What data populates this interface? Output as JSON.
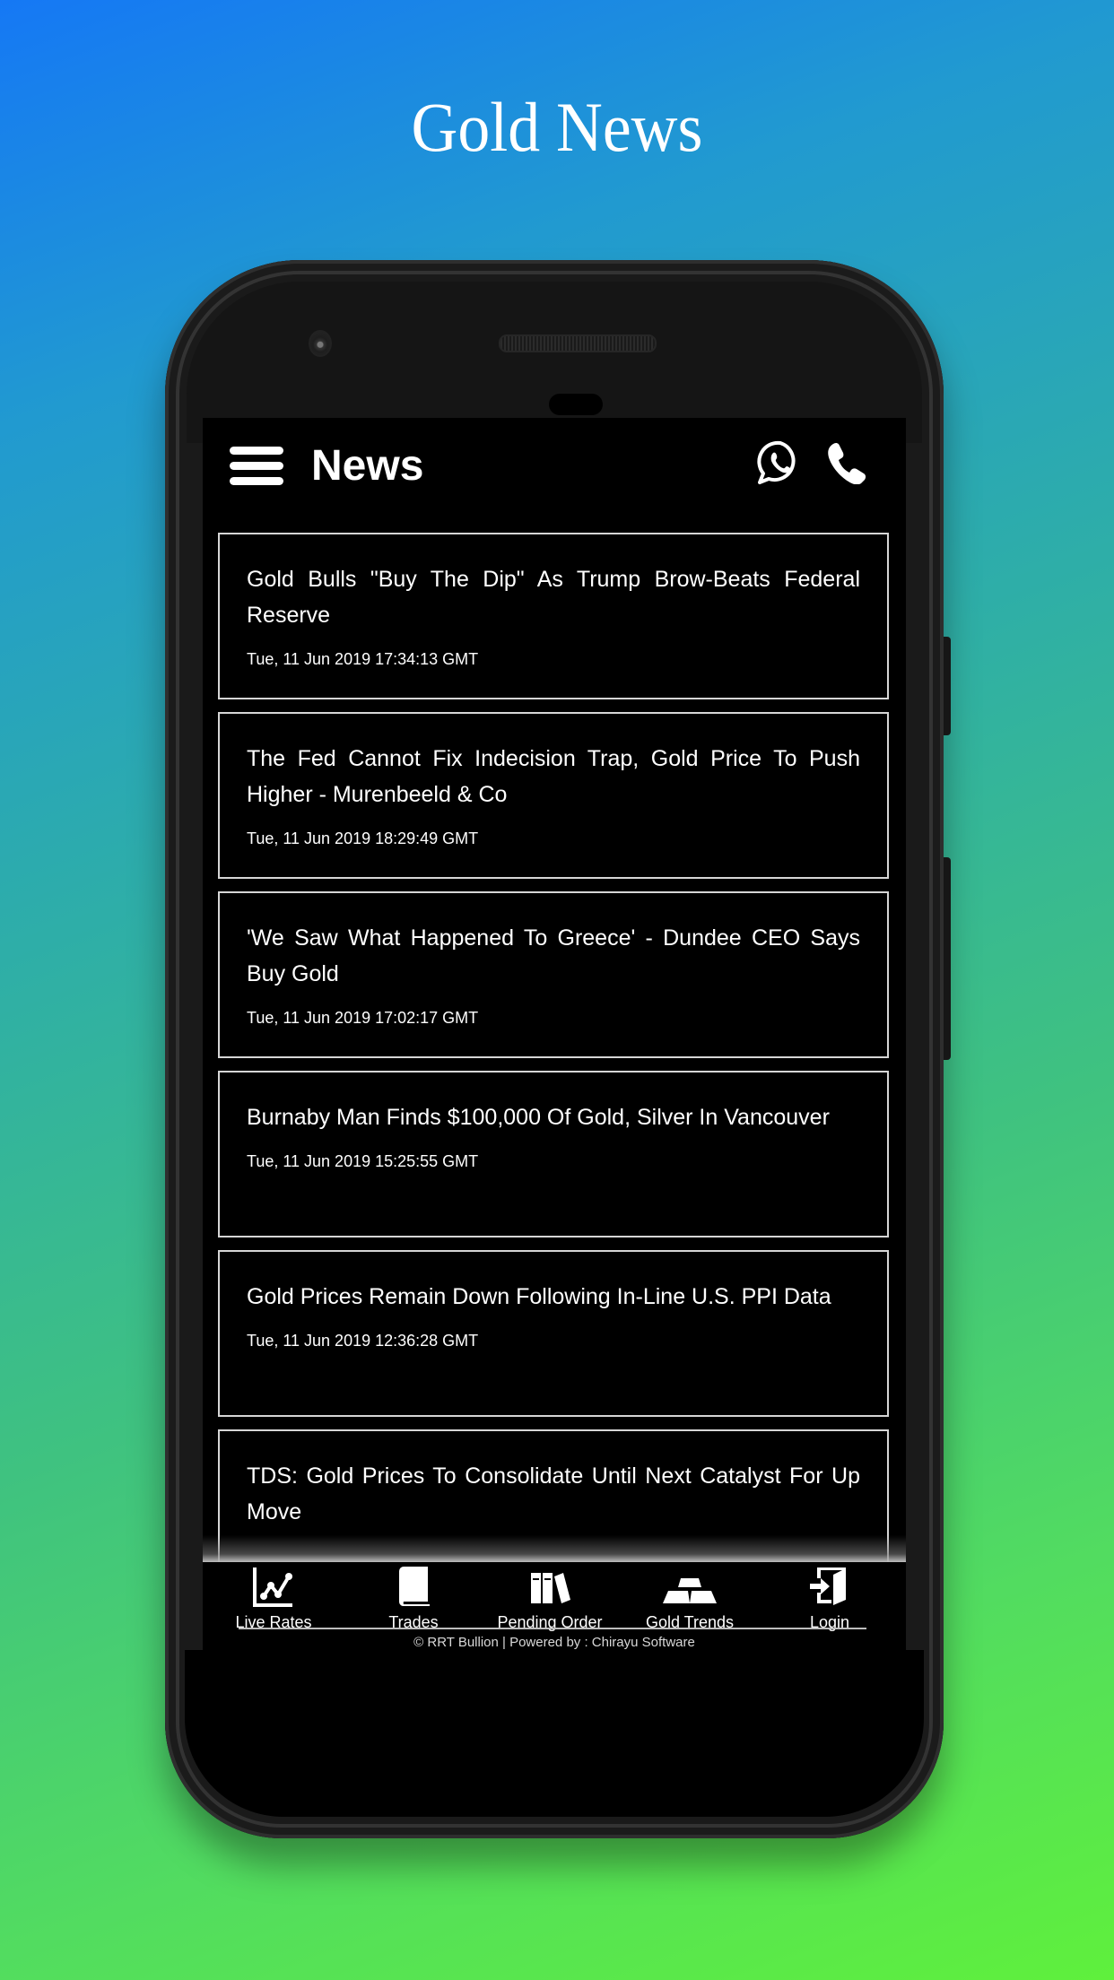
{
  "promo": {
    "title": "Gold News"
  },
  "header": {
    "title": "News",
    "icons": {
      "menu": "hamburger-menu-icon",
      "whatsapp": "whatsapp-icon",
      "call": "phone-call-icon"
    }
  },
  "news": [
    {
      "title": "Gold Bulls \"Buy The Dip\" As Trump Brow-Beats Federal Reserve",
      "date": "Tue, 11 Jun 2019 17:34:13 GMT"
    },
    {
      "title": "The Fed Cannot Fix Indecision Trap, Gold Price To Push Higher - Murenbeeld & Co",
      "date": "Tue, 11 Jun 2019 18:29:49 GMT"
    },
    {
      "title": "'We Saw What Happened To Greece' - Dundee CEO Says Buy Gold",
      "date": "Tue, 11 Jun 2019 17:02:17 GMT"
    },
    {
      "title": "Burnaby Man Finds $100,000 Of Gold, Silver In Vancouver",
      "date": "Tue, 11 Jun 2019 15:25:55 GMT"
    },
    {
      "title": "Gold Prices Remain Down Following In-Line U.S. PPI Data",
      "date": "Tue, 11 Jun 2019 12:36:28 GMT"
    },
    {
      "title": "TDS: Gold Prices To Consolidate Until Next Catalyst For Up Move",
      "date": ""
    }
  ],
  "tabs": [
    {
      "label": "Live Rates",
      "icon": "line-chart-icon"
    },
    {
      "label": "Trades",
      "icon": "book-icon"
    },
    {
      "label": "Pending Order",
      "icon": "books-icon"
    },
    {
      "label": "Gold Trends",
      "icon": "gold-bars-icon"
    },
    {
      "label": "Login",
      "icon": "login-door-icon"
    }
  ],
  "footer": {
    "text": "© RRT Bullion |  Powered by : Chirayu Software"
  },
  "colors": {
    "screen_bg": "#000000",
    "text": "#ffffff",
    "card_border": "#d6d6d6"
  }
}
